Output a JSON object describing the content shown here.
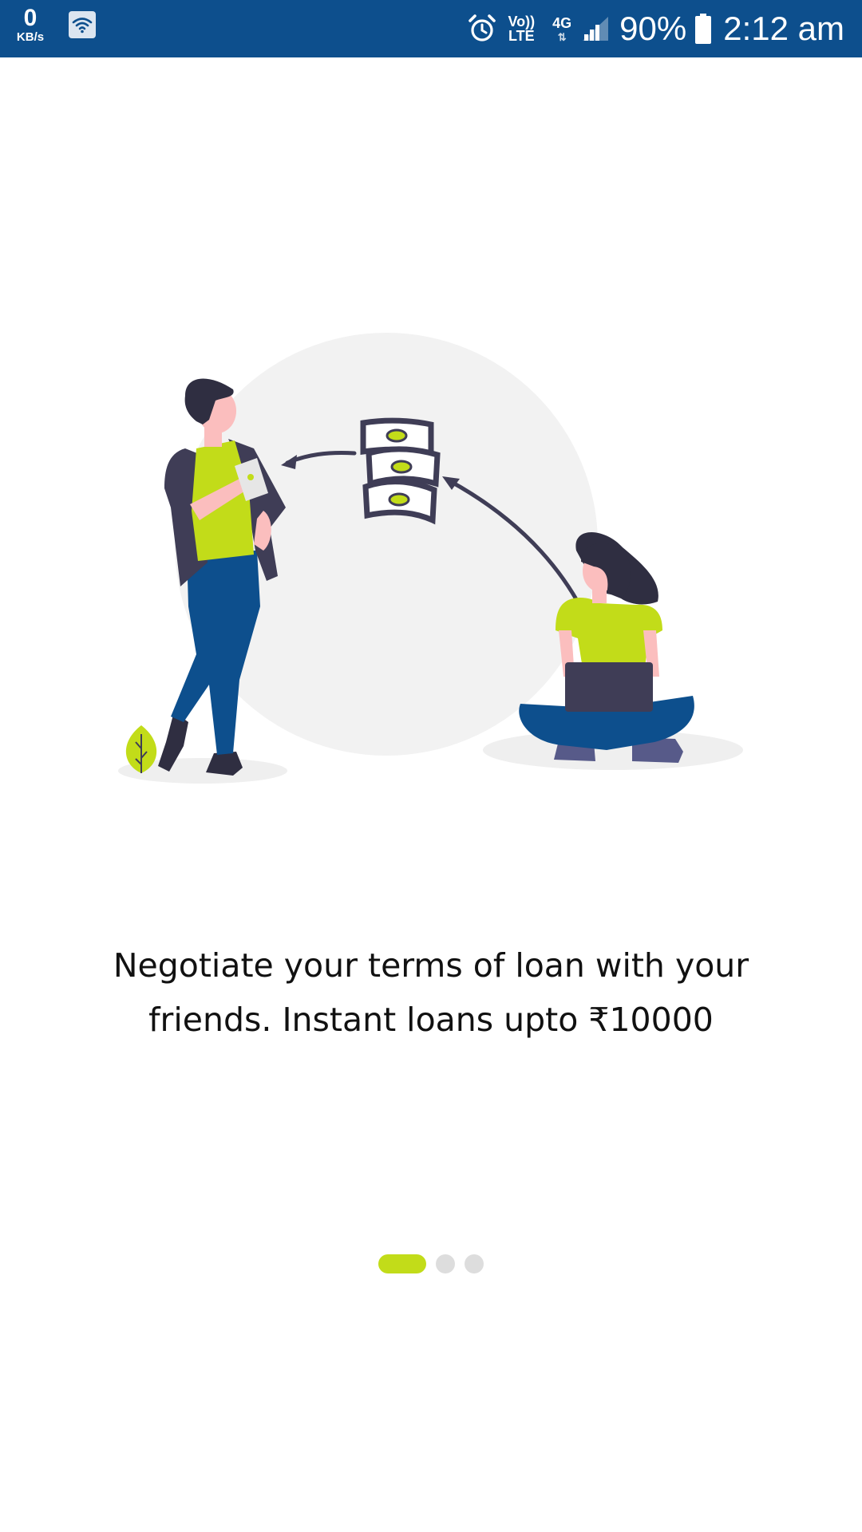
{
  "status_bar": {
    "net_speed_value": "0",
    "net_speed_unit": "KB/s",
    "volte_top": "Vo))",
    "volte_bottom": "LTE",
    "network_type": "4G",
    "battery_percent": "90%",
    "time": "2:12 am",
    "icons": [
      "wifi-icon",
      "alarm-icon",
      "signal-icon",
      "battery-icon"
    ],
    "background_color": "#0d4f8d"
  },
  "onboarding": {
    "caption_line1": "Negotiate your terms of loan with your",
    "caption_line2": "friends. Instant loans upto ₹10000",
    "illustration_icons": [
      "man-figure",
      "woman-with-laptop-figure",
      "money-stack-icon",
      "plant-icon"
    ],
    "accent_color": "#c2dc19",
    "pager": {
      "total_pages": 3,
      "active_index": 0
    }
  }
}
